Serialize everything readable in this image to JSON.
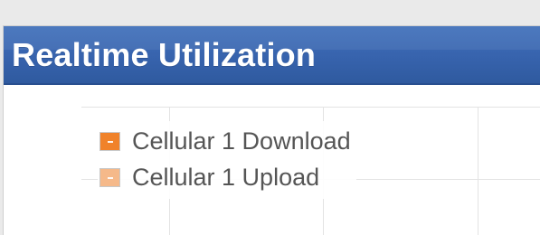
{
  "panel": {
    "title": "Realtime Utilization"
  },
  "legend": {
    "items": [
      {
        "label": "Cellular 1 Download",
        "color": "#f0822a"
      },
      {
        "label": "Cellular 1 Upload",
        "color": "#f5b98a"
      }
    ]
  },
  "colors": {
    "header_bg": "#3763ad",
    "title_text": "#ffffff",
    "grid": "#e3e3e3",
    "legend_text": "#555555"
  }
}
